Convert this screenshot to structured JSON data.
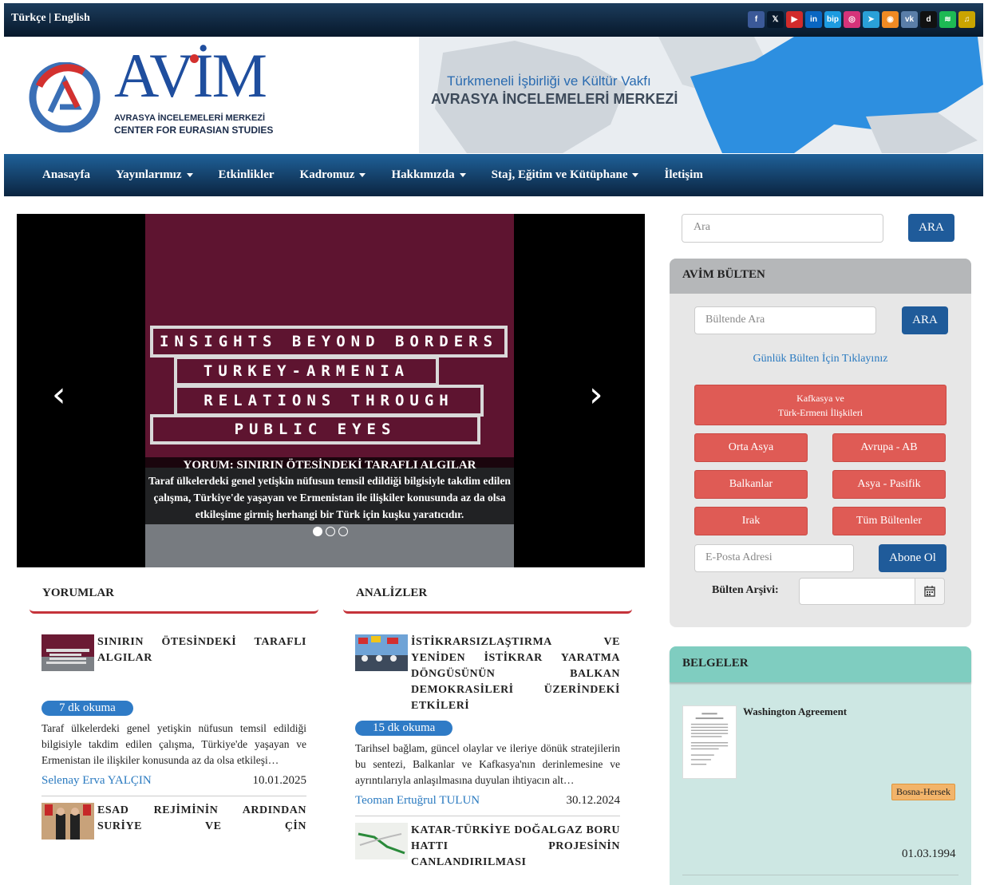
{
  "topbar": {
    "lang_tr": "Türkçe",
    "lang_sep": " | ",
    "lang_en": "English",
    "social_icons": [
      {
        "name": "facebook-icon",
        "glyph": "f",
        "color": "#3b5998"
      },
      {
        "name": "x-icon",
        "glyph": "𝕏",
        "color": "#07182b"
      },
      {
        "name": "youtube-icon",
        "glyph": "▶",
        "color": "#d12b2b"
      },
      {
        "name": "linkedin-icon",
        "glyph": "in",
        "color": "#0a66c2"
      },
      {
        "name": "bip-icon",
        "glyph": "bip",
        "color": "#1d9be0"
      },
      {
        "name": "instagram-icon",
        "glyph": "◎",
        "color": "#d6337a"
      },
      {
        "name": "telegram-icon",
        "glyph": "➤",
        "color": "#2aa0d8"
      },
      {
        "name": "rss-icon",
        "glyph": "◉",
        "color": "#f08a24"
      },
      {
        "name": "vk-icon",
        "glyph": "vk",
        "color": "#5a7ea8"
      },
      {
        "name": "dailymotion-icon",
        "glyph": "d",
        "color": "#111111"
      },
      {
        "name": "spotify-icon",
        "glyph": "≋",
        "color": "#1db954"
      },
      {
        "name": "podcast-icon",
        "glyph": "♫",
        "color": "#c9a400"
      }
    ]
  },
  "header": {
    "logo_word": "AVİM",
    "logo_sub1": "AVRASYA İNCELEMELERİ MERKEZİ",
    "logo_sub2": "CENTER FOR EURASIAN STUDIES",
    "tagline1": "Türkmeneli İşbirliği ve Kültür Vakfı",
    "tagline2": "AVRASYA İNCELEMELERİ MERKEZİ"
  },
  "nav": {
    "items": [
      {
        "label": "Anasayfa",
        "dropdown": false
      },
      {
        "label": "Yayınlarımız",
        "dropdown": true
      },
      {
        "label": "Etkinlikler",
        "dropdown": false
      },
      {
        "label": "Kadromuz",
        "dropdown": true
      },
      {
        "label": "Hakkımızda",
        "dropdown": true
      },
      {
        "label": "Staj, Eğitim ve Kütüphane",
        "dropdown": true
      },
      {
        "label": "İletişim",
        "dropdown": false
      }
    ]
  },
  "slider": {
    "image_lines": [
      "INSIGHTS BEYOND BORDERS",
      "TURKEY-ARMENIA",
      "RELATIONS THROUGH",
      "PUBLIC EYES"
    ],
    "caption_title": "YORUM: SINIRIN ÖTESİNDEKİ TARAFLI ALGILAR",
    "caption_text": "Taraf ülkelerdeki genel yetişkin nüfusun temsil edildiği bilgisiyle takdim edilen çalışma, Türkiye'de yaşayan ve Ermenistan ile ilişkiler konusunda az da olsa etkileşime girmiş herhangi bir Türk için kuşku yaratıcıdır.",
    "prev_glyph": "‹",
    "next_glyph": "›",
    "dots": 3,
    "active_dot": 0
  },
  "yorumlar": {
    "heading": "YORUMLAR",
    "article1": {
      "title": "SINIRIN ÖTESİNDEKİ TARAFLI ALGILAR",
      "badge": "7 dk okuma",
      "excerpt": "Taraf ülkelerdeki genel yetişkin nüfusun temsil edildiği bilgisiyle takdim edilen çalışma, Türkiye'de yaşayan ve Ermenistan ile ilişkiler konusunda az da olsa etkileşi…",
      "author": "Selenay Erva YALÇIN",
      "date": "10.01.2025"
    },
    "article2": {
      "title": "ESAD REJİMİNİN ARDINDAN SURİYE VE ÇİN"
    }
  },
  "analizler": {
    "heading": "ANALİZLER",
    "article1": {
      "title": "İSTİKRARSIZLAŞTIRMA VE YENİDEN İSTİKRAR YARATMA DÖNGÜSÜNÜN BALKAN DEMOKRASİLERİ ÜZERİNDEKİ ETKİLERİ",
      "badge": "15 dk okuma",
      "excerpt": "Tarihsel bağlam, güncel olaylar ve ileriye dönük stratejilerin bu sentezi, Balkanlar ve Kafkasya'nın derinlemesine ve ayrıntılarıyla anlaşılmasına duyulan ihtiyacın alt…",
      "author": "Teoman Ertuğrul TULUN",
      "date": "30.12.2024"
    },
    "article2": {
      "title": "KATAR-TÜRKİYE DOĞALGAZ BORU HATTI PROJESİNİN CANLANDIRILMASI"
    }
  },
  "sidebar": {
    "search_placeholder": "Ara",
    "search_button": "ARA",
    "bulten": {
      "heading": "AVİM BÜLTEN",
      "search_placeholder": "Bültende Ara",
      "search_button": "ARA",
      "daily_link": "Günlük Bülten İçin Tıklayınız",
      "caucasus_line1": "Kafkasya ve",
      "caucasus_line2": "Türk-Ermeni İlişkileri",
      "orta_asya": "Orta Asya",
      "avrupa": "Avrupa - AB",
      "balkanlar": "Balkanlar",
      "asya_pasifik": "Asya - Pasifik",
      "irak": "Irak",
      "tum": "Tüm Bültenler",
      "email_placeholder": "E-Posta Adresi",
      "subscribe": "Abone Ol",
      "archive_label": "Bülten Arşivi:"
    },
    "belgeler": {
      "heading": "BELGELER",
      "doc_title": "Washington Agreement",
      "tag": "Bosna-Hersek",
      "date": "01.03.1994"
    }
  },
  "colors": {
    "nav_top": "#1f6199",
    "accent_blue": "#1f5b9a",
    "red_button": "#df5b55",
    "section_underline": "#c5333a",
    "belgeler_head": "#7fcdc0",
    "badge_blue": "#2f7bc6"
  }
}
